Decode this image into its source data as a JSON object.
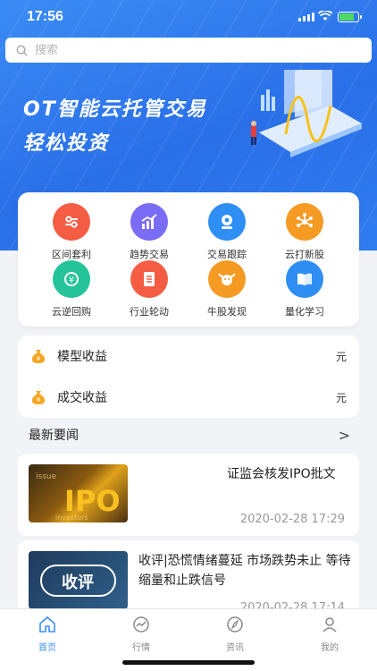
{
  "status": {
    "time": "17:56"
  },
  "search": {
    "placeholder": "搜索"
  },
  "banner": {
    "line1": "OT智能云托管交易",
    "line2": "轻松投资"
  },
  "quick_actions": [
    {
      "label": "区间套利",
      "icon": "sliders-icon",
      "color": "#f45c43"
    },
    {
      "label": "趋势交易",
      "icon": "trend-chart-icon",
      "color": "#7b6cf6"
    },
    {
      "label": "交易跟踪",
      "icon": "tracking-icon",
      "color": "#2f8ef3"
    },
    {
      "label": "云打新股",
      "icon": "network-icon",
      "color": "#f59a23"
    },
    {
      "label": "云逆回购",
      "icon": "repurchase-icon",
      "color": "#24c39a"
    },
    {
      "label": "行业轮动",
      "icon": "document-icon",
      "color": "#f45c43"
    },
    {
      "label": "牛股发现",
      "icon": "bull-icon",
      "color": "#f59a23"
    },
    {
      "label": "量化学习",
      "icon": "book-icon",
      "color": "#2f8ef3"
    }
  ],
  "profit": [
    {
      "label": "模型收益",
      "unit": "元"
    },
    {
      "label": "成交收益",
      "unit": "元"
    }
  ],
  "news": {
    "heading": "最新要闻",
    "more_arrow": ">",
    "items": [
      {
        "title": "证监会核发IPO批文",
        "date": "2020-02-28 17:29",
        "thumb_text": "IPO"
      },
      {
        "title": "收评|恐慌情绪蔓延 市场跌势未止 等待缩量和止跌信号",
        "date": "2020-02-28 17:14",
        "thumb_text": "收评"
      }
    ]
  },
  "tabbar": [
    {
      "label": "首页",
      "icon": "home-icon",
      "active": true
    },
    {
      "label": "行情",
      "icon": "market-icon",
      "active": false
    },
    {
      "label": "资讯",
      "icon": "compass-icon",
      "active": false
    },
    {
      "label": "我的",
      "icon": "user-icon",
      "active": false
    }
  ],
  "colors": {
    "brand": "#2a6fe8",
    "active_tab": "#3d8ef7",
    "bag": "#f5a623"
  }
}
